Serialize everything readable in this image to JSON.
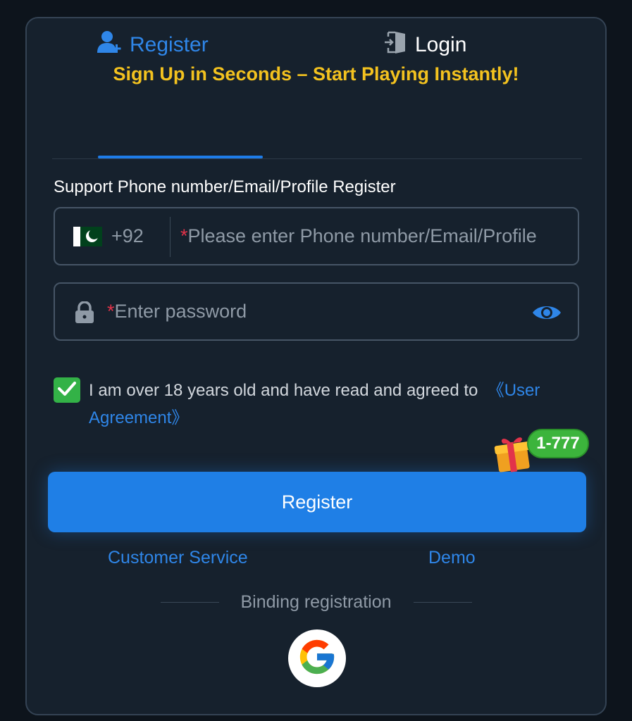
{
  "headline": "Sign Up in Seconds – Start Playing Instantly!",
  "tabs": {
    "register": "Register",
    "login": "Login"
  },
  "form": {
    "support_label": "Support Phone number/Email/Profile Register",
    "country_code": "+92",
    "phone_placeholder": "Please enter Phone number/Email/Profile",
    "password_placeholder": "Enter password",
    "required_mark": "*"
  },
  "agreement": {
    "checked": true,
    "text": "I am over 18 years old and have read and agreed to",
    "link": "《User Agreement》"
  },
  "bonus_badge": "1-777",
  "register_button": "Register",
  "links": {
    "customer_service": "Customer Service",
    "demo": "Demo"
  },
  "binding_label": "Binding registration",
  "colors": {
    "accent": "#1f7fe6",
    "headline": "#f3c21f",
    "card_bg": "#16212d",
    "check_green": "#33b247"
  },
  "icons": {
    "register_tab": "add-user-icon",
    "login_tab": "door-login-icon",
    "flag": "pakistan-flag-icon",
    "lock": "lock-icon",
    "eye": "eye-icon",
    "check": "check-icon",
    "gift": "gift-icon",
    "google": "google-icon"
  }
}
